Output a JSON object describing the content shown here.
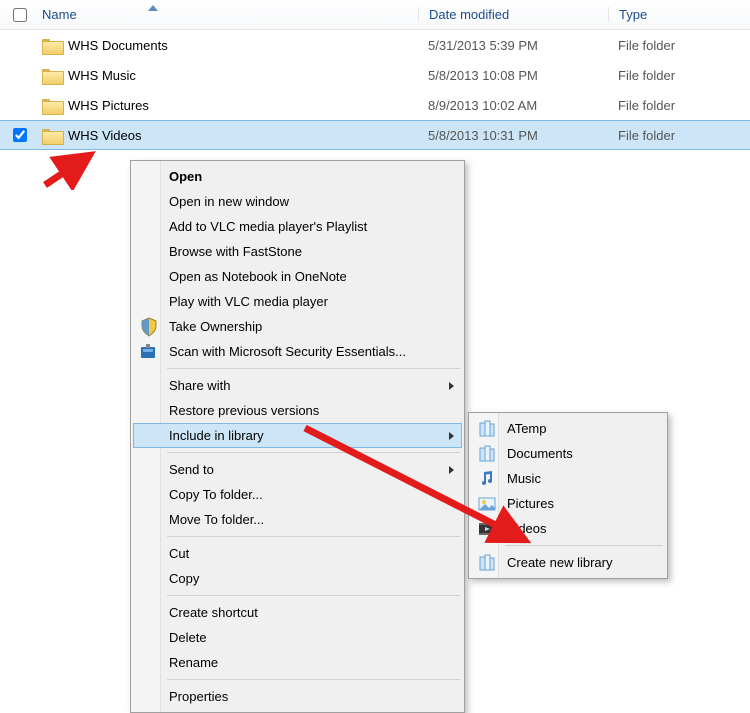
{
  "columns": {
    "name": "Name",
    "modified": "Date modified",
    "type": "Type"
  },
  "rows": [
    {
      "name": "WHS Documents",
      "modified": "5/31/2013 5:39 PM",
      "type": "File folder",
      "selected": false
    },
    {
      "name": "WHS Music",
      "modified": "5/8/2013 10:08 PM",
      "type": "File folder",
      "selected": false
    },
    {
      "name": "WHS Pictures",
      "modified": "8/9/2013 10:02 AM",
      "type": "File folder",
      "selected": false
    },
    {
      "name": "WHS Videos",
      "modified": "5/8/2013 10:31 PM",
      "type": "File folder",
      "selected": true
    }
  ],
  "menu": {
    "open": "Open",
    "open_new": "Open in new window",
    "vlc_playlist": "Add to VLC media player's Playlist",
    "faststone": "Browse with FastStone",
    "onenote": "Open as Notebook in OneNote",
    "vlc_play": "Play with VLC media player",
    "take_ownership": "Take Ownership",
    "mse_scan": "Scan with Microsoft Security Essentials...",
    "share_with": "Share with",
    "restore": "Restore previous versions",
    "include_library": "Include in library",
    "send_to": "Send to",
    "copy_to": "Copy To folder...",
    "move_to": "Move To folder...",
    "cut": "Cut",
    "copy": "Copy",
    "shortcut": "Create shortcut",
    "delete": "Delete",
    "rename": "Rename",
    "properties": "Properties"
  },
  "submenu": {
    "atemp": "ATemp",
    "documents": "Documents",
    "music": "Music",
    "pictures": "Pictures",
    "videos": "Videos",
    "create": "Create new library"
  }
}
